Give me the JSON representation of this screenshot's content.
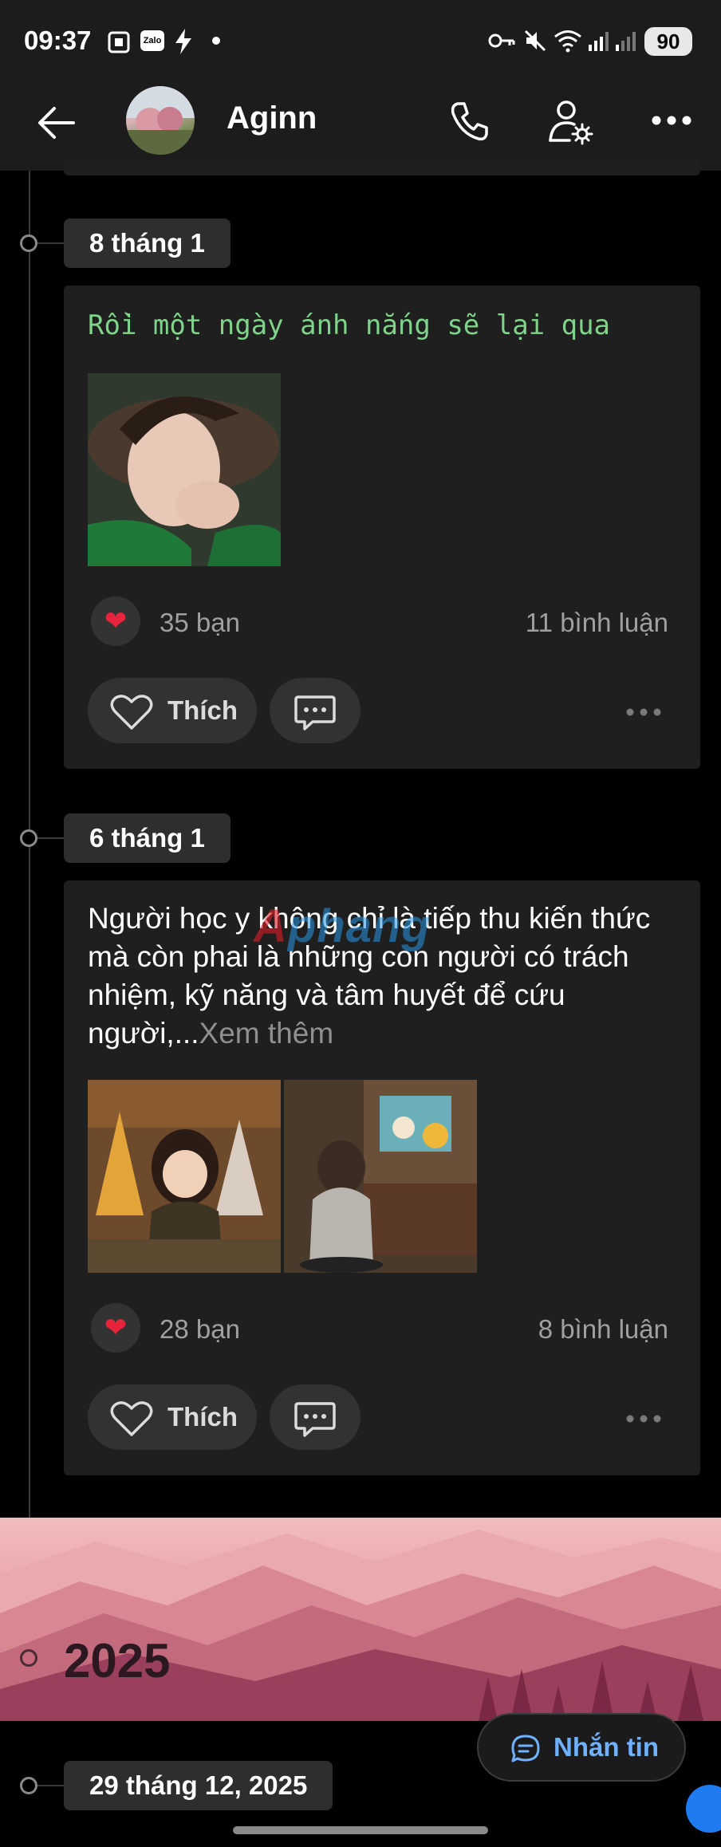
{
  "status_bar": {
    "time": "09:37",
    "zalo_badge": "Zalo",
    "battery": "90"
  },
  "header": {
    "title": "Aginn",
    "icons": [
      "back-arrow-icon",
      "phone-icon",
      "profile-settings-icon",
      "more-icon"
    ]
  },
  "posts": [
    {
      "date": "8 tháng 1",
      "title": "Rồi một ngày ánh nắng sẽ lại qua",
      "reactions": "35 bạn",
      "comments": "11 bình luận",
      "like_label": "Thích"
    },
    {
      "date": "6 tháng 1",
      "text": "Người học y không chỉ là tiếp thu kiến thức mà còn phai là những con người có trách nhiệm, kỹ năng và tâm huyết để cứu người,...",
      "see_more": "Xem thêm",
      "reactions": "28 bạn",
      "comments": "8 bình luận",
      "like_label": "Thích"
    }
  ],
  "year_banner": {
    "year": "2025"
  },
  "next_date": "29 tháng 12, 2025",
  "message_button": {
    "label": "Nhắn tin"
  },
  "watermark": {
    "a": "A",
    "rest": "phang"
  },
  "colors": {
    "background": "#000000",
    "card": "#1f1f1f",
    "accent_green": "#7fd38a",
    "heart": "#e8243c",
    "message_blue": "#6fb0ff"
  }
}
